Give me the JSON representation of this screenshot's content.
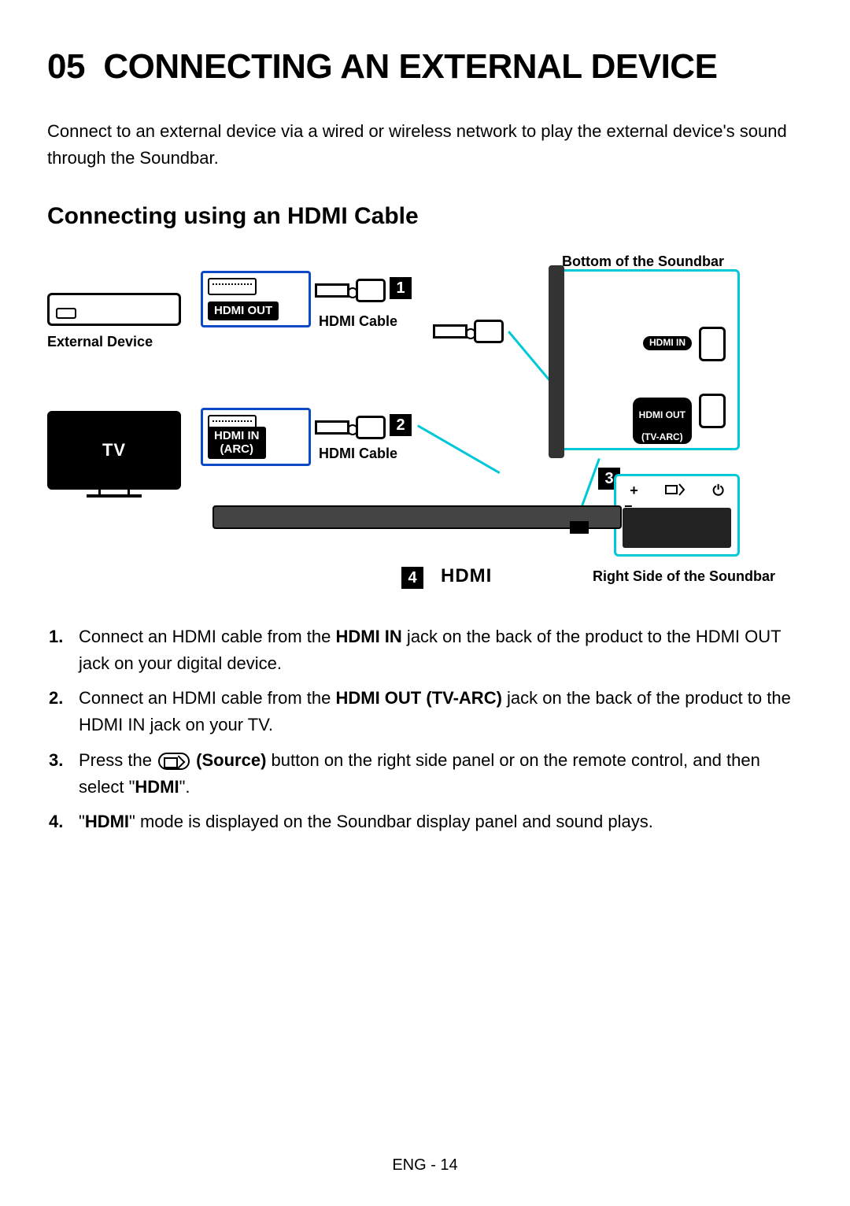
{
  "chapter": {
    "number": "05",
    "title": "CONNECTING AN EXTERNAL DEVICE"
  },
  "intro": "Connect to an external device via a wired or wireless network to play the external device's sound through the Soundbar.",
  "section_title": "Connecting using an HDMI Cable",
  "diagram": {
    "external_device_label": "External Device",
    "tv_label": "TV",
    "hdmi_out_label": "HDMI OUT",
    "hdmi_in_arc_line1": "HDMI IN",
    "hdmi_in_arc_line2": "(ARC)",
    "hdmi_cable_label": "HDMI Cable",
    "bottom_label": "Bottom of the Soundbar",
    "port_in_label": "HDMI IN",
    "port_out_line1": "HDMI OUT",
    "port_out_line2": "(TV-ARC)",
    "right_side_label": "Right Side of the Soundbar",
    "hdmi_mode_label": "HDMI",
    "step_1": "1",
    "step_2": "2",
    "step_3": "3",
    "step_4": "4",
    "side_button_plus": "+",
    "side_button_minus": "−",
    "side_button_power": "⏻"
  },
  "steps": {
    "s1_a": "Connect an HDMI cable from the ",
    "s1_b": "HDMI IN",
    "s1_c": " jack on the back of the product to the HDMI OUT jack on your digital device.",
    "s2_a": "Connect an HDMI cable from the ",
    "s2_b": "HDMI OUT (TV-ARC)",
    "s2_c": " jack on the back of the product to the HDMI IN jack on your TV.",
    "s3_a": "Press the ",
    "s3_b": "(Source)",
    "s3_c": " button on the right side panel or on the remote control, and then select \"",
    "s3_d": "HDMI",
    "s3_e": "\".",
    "s4_a": "\"",
    "s4_b": "HDMI",
    "s4_c": "\" mode is displayed on the Soundbar display panel and sound plays."
  },
  "footer": "ENG - 14"
}
